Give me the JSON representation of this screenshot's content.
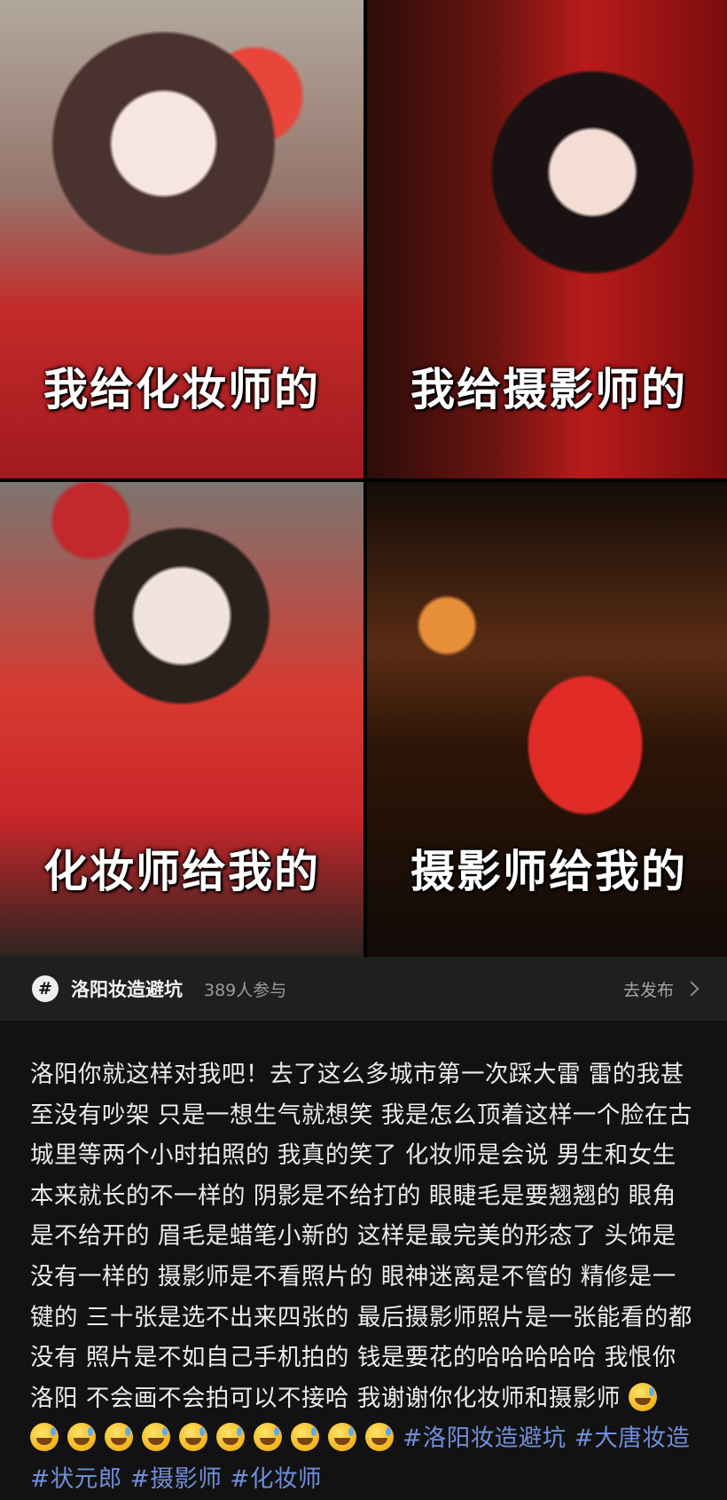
{
  "photos": [
    {
      "caption": "我给化妆师的"
    },
    {
      "caption": "我给摄影师的"
    },
    {
      "caption": "化妆师给我的"
    },
    {
      "caption": "摄影师给我的"
    }
  ],
  "topic": {
    "icon": "hashtag-icon",
    "name": "洛阳妆造避坑",
    "count": "389人参与",
    "action": "去发布"
  },
  "post": {
    "text": "洛阳你就这样对我吧！去了这么多城市第一次踩大雷 雷的我甚至没有吵架 只是一想生气就想笑 我是怎么顶着这样一个脸在古城里等两个小时拍照的 我真的笑了 化妆师是会说 男生和女生本来就长的不一样的 阴影是不给打的 眼睫毛是要翘翘的 眼角是不给开的 眉毛是蜡笔小新的 这样是最完美的形态了 头饰是没有一样的 摄影师是不看照片的 眼神迷离是不管的 精修是一键的 三十张是选不出来四张的 最后摄影师照片是一张能看的都没有 照片是不如自己手机拍的 钱是要花的哈哈哈哈哈 我恨你洛阳 不会画不会拍可以不接哈 我谢谢你化妆师和摄影师",
    "emoji_name": "sweat-smile-emoji",
    "hashtags": [
      "#洛阳妆造避坑",
      "#大唐妆造",
      "#状元郎",
      "#摄影师",
      "#化妆师"
    ]
  },
  "colors": {
    "background": "#121212",
    "topic_bar": "#1f1f1f",
    "hashtag": "#6f8fd9"
  }
}
